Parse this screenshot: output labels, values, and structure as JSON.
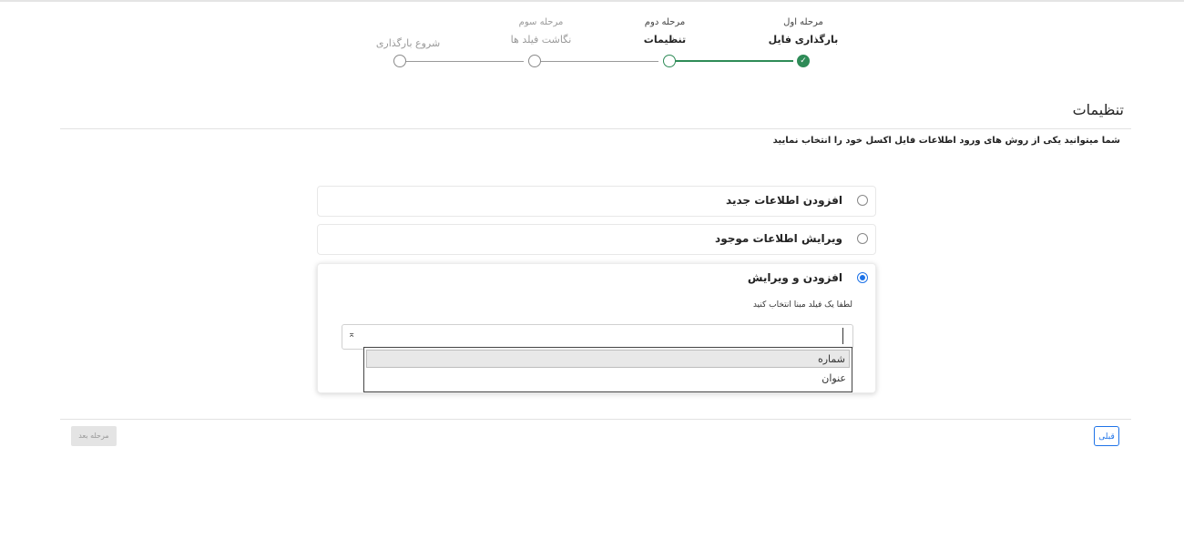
{
  "stepper": {
    "steps": [
      {
        "sub": "مرحله اول",
        "title": "بارگذاری فایل",
        "state": "done"
      },
      {
        "sub": "مرحله دوم",
        "title": "تنظیمات",
        "state": "current"
      },
      {
        "sub": "مرحله سوم",
        "title": "نگاشت فیلد ها",
        "state": "pending"
      },
      {
        "sub": "",
        "title": "شروع بارگذاری",
        "state": "pending"
      }
    ],
    "done_glyph": "✓"
  },
  "section": {
    "title": "تنظیمات",
    "instructions": "شما میتوانید یکی از روش های ورود اطلاعات فایل اکسل خود را انتخاب نمایید"
  },
  "options": [
    {
      "label": "افزودن اطلاعات جدید",
      "checked": false
    },
    {
      "label": "ویرایش اطلاعات موجود",
      "checked": false
    },
    {
      "label": "افزودن و ویرایش",
      "checked": true
    }
  ],
  "base_field": {
    "hint": "لطفا یک فیلد مبنا انتخاب کنید",
    "value": "",
    "clear_glyph": "⌅",
    "dropdown_options": [
      "شماره",
      "عنوان"
    ],
    "highlighted_option": "شماره"
  },
  "footer": {
    "prev_label": "قبلی",
    "next_label": "مرحله بعد"
  },
  "colors": {
    "success": "#2e8b57",
    "primary": "#1e73e8",
    "disabled_bg": "#e4e4e4"
  }
}
